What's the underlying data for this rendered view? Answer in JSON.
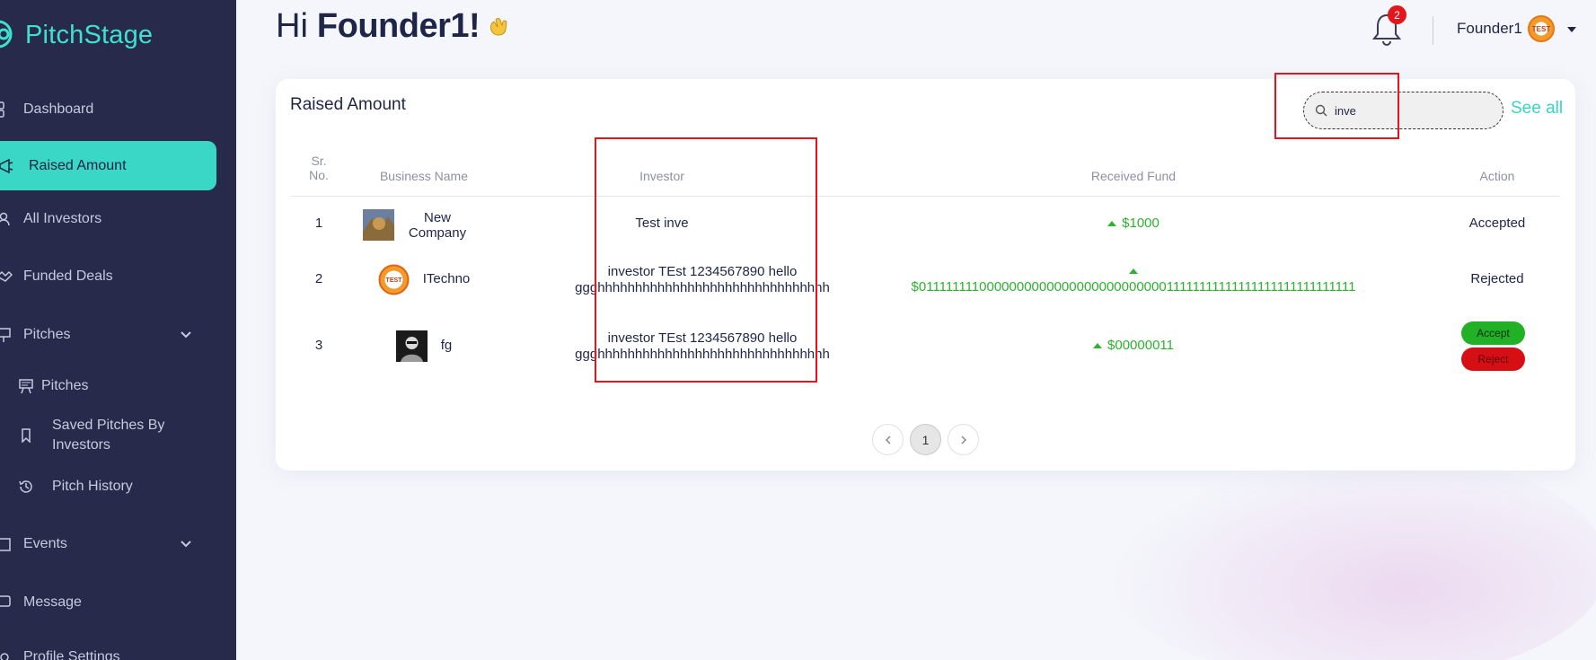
{
  "sidebar": {
    "logo": "PitchStage",
    "items": [
      {
        "label": "Dashboard",
        "icon": "dashboard-icon"
      },
      {
        "label": "Raised Amount",
        "icon": "megaphone-icon"
      },
      {
        "label": "All Investors",
        "icon": "users-icon"
      },
      {
        "label": "Funded Deals",
        "icon": "handshake-icon"
      },
      {
        "label": "Pitches",
        "icon": "presentation-icon"
      },
      {
        "label": "Pitches",
        "icon": "presentation-board-icon"
      },
      {
        "label": "Saved Pitches By Investors",
        "icon": "bookmark-icon"
      },
      {
        "label": "Pitch History",
        "icon": "history-icon"
      },
      {
        "label": "Events",
        "icon": "calendar-icon"
      },
      {
        "label": "Message",
        "icon": "chat-icon"
      },
      {
        "label": "Profile Settings",
        "icon": "settings-icon"
      }
    ]
  },
  "header": {
    "greeting": "Hi",
    "name": "Founder1!",
    "notifications": "2",
    "user": "Founder1",
    "avatar_text": "TEST"
  },
  "card": {
    "title": "Raised Amount",
    "search_value": "inve",
    "see_all": "See all",
    "columns": {
      "sr_line1": "Sr.",
      "sr_line2": "No.",
      "business": "Business Name",
      "investor": "Investor",
      "fund": "Received Fund",
      "action": "Action"
    },
    "rows": [
      {
        "sr": "1",
        "business": "New Company",
        "investor": "Test inve",
        "fund": "$1000",
        "action": "Accepted"
      },
      {
        "sr": "2",
        "business": "ITechno",
        "investor_line1": "investor TEst 1234567890 hello",
        "investor_line2": "ggghhhhhhhhhhhhhhhhhhhhhhhhhhhhhhh",
        "fund": "$011111111000000000000000000000000011111111111111111111111111111",
        "action": "Rejected"
      },
      {
        "sr": "3",
        "business": "fg",
        "investor_line1": "investor TEst 1234567890 hello",
        "investor_line2": "ggghhhhhhhhhhhhhhhhhhhhhhhhhhhhhhh",
        "fund": "$00000011",
        "accept": "Accept",
        "reject": "Reject"
      }
    ],
    "page": "1"
  },
  "colors": {
    "sidebar": "#272a4b",
    "accent": "#3ad6c6",
    "positive": "#2db12f",
    "danger": "#d60f14"
  }
}
